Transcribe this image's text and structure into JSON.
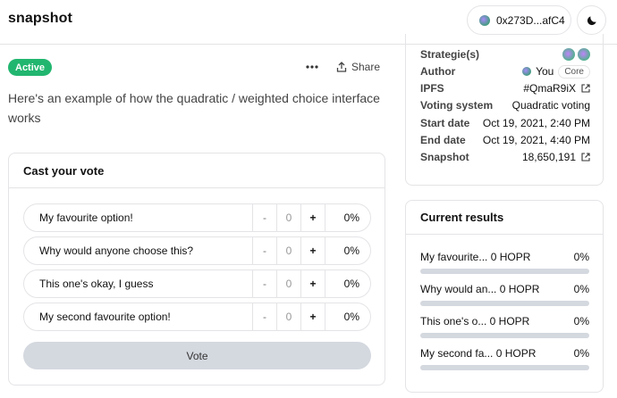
{
  "header": {
    "logo": "snapshot",
    "account": "0x273D...afC4"
  },
  "proposal": {
    "status": "Active",
    "share_label": "Share",
    "description": "Here's an example of how the quadratic / weighted choice interface works"
  },
  "vote": {
    "title": "Cast your vote",
    "choices": [
      {
        "label": "My favourite option!",
        "minus": "-",
        "value": "0",
        "plus": "+",
        "percent": "0%"
      },
      {
        "label": "Why would anyone choose this?",
        "minus": "-",
        "value": "0",
        "plus": "+",
        "percent": "0%"
      },
      {
        "label": "This one's okay, I guess",
        "minus": "-",
        "value": "0",
        "plus": "+",
        "percent": "0%"
      },
      {
        "label": "My second favourite option!",
        "minus": "-",
        "value": "0",
        "plus": "+",
        "percent": "0%"
      }
    ],
    "button": "Vote"
  },
  "info": {
    "strategies_label": "Strategie(s)",
    "author_label": "Author",
    "author_value": "You",
    "author_badge": "Core",
    "ipfs_label": "IPFS",
    "ipfs_value": "#QmaR9iX",
    "voting_system_label": "Voting system",
    "voting_system_value": "Quadratic voting",
    "start_label": "Start date",
    "start_value": "Oct 19, 2021, 2:40 PM",
    "end_label": "End date",
    "end_value": "Oct 19, 2021, 4:40 PM",
    "snapshot_label": "Snapshot",
    "snapshot_value": "18,650,191"
  },
  "results": {
    "title": "Current results",
    "items": [
      {
        "label": "My favourite... 0 HOPR",
        "percent": "0%"
      },
      {
        "label": "Why would an... 0 HOPR",
        "percent": "0%"
      },
      {
        "label": "This one's o... 0 HOPR",
        "percent": "0%"
      },
      {
        "label": "My second fa... 0 HOPR",
        "percent": "0%"
      }
    ]
  },
  "colors": {
    "active_badge": "#21b66f",
    "vote_button": "#d4d8df",
    "border": "#e4e4e7"
  },
  "icons": [
    "account-avatar-icon",
    "moon-icon",
    "more-dots-icon",
    "share-icon",
    "external-link-icon"
  ]
}
